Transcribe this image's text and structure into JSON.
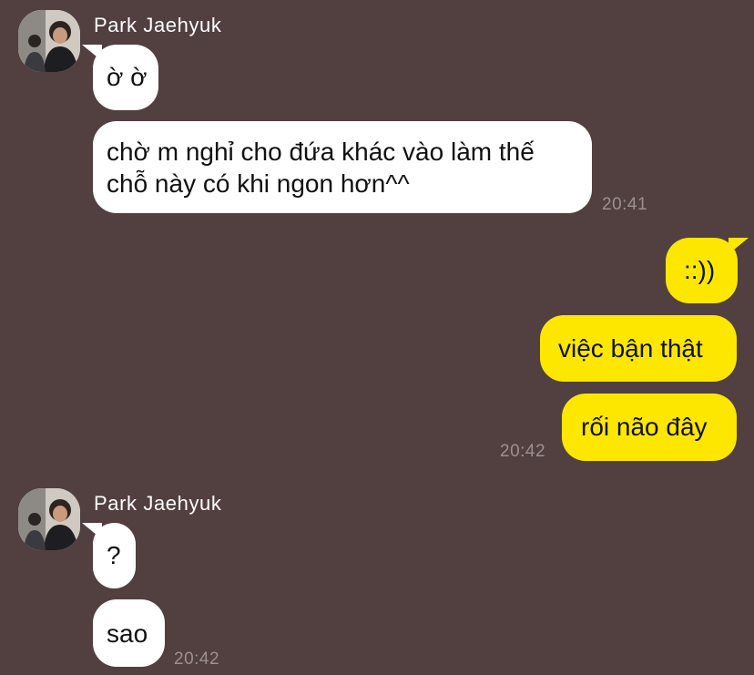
{
  "sender_name": "Park Jaehyuk",
  "colors": {
    "background": "#523f40",
    "incoming_bubble": "#ffffff",
    "outgoing_bubble": "#fde701",
    "timestamp": "#9d9092"
  },
  "groups": [
    {
      "direction": "incoming",
      "sender": "Park Jaehyuk",
      "messages": [
        "ờ ờ",
        "chờ m nghỉ cho đứa khác vào làm thế chỗ này có khi ngon hơn^^"
      ],
      "message_lines": [
        [
          "ờ ờ"
        ],
        [
          "chờ m nghỉ cho đứa khác vào làm thế",
          "chỗ này có khi ngon hơn^^"
        ]
      ],
      "time": "20:41"
    },
    {
      "direction": "outgoing",
      "messages": [
        "::))",
        "việc bận thật",
        "rối não đây"
      ],
      "time": "20:42"
    },
    {
      "direction": "incoming",
      "sender": "Park Jaehyuk",
      "messages": [
        "?",
        "sao"
      ],
      "time": "20:42"
    }
  ]
}
